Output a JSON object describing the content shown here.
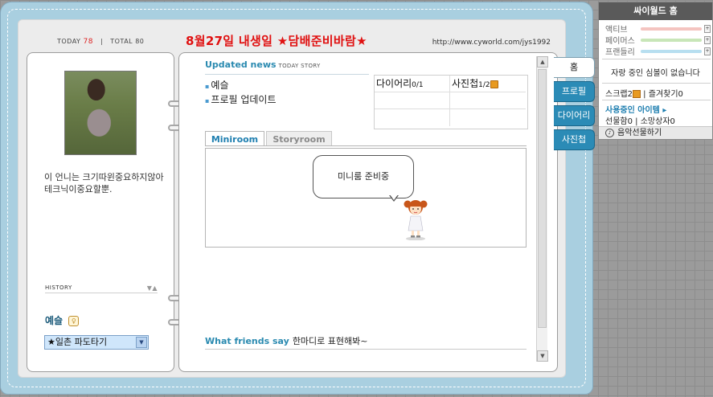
{
  "header": {
    "today_label": "TODAY",
    "today_count": "78",
    "total_label": "TOTAL",
    "total_count": "80",
    "headline": "8월27일 내생일  ★담배준비바람★",
    "url": "http://www.cyworld.com/jys1992"
  },
  "profile": {
    "intro": "이 언니는 크기따윈중요하지않아 테크닉이중요할뿐.",
    "history_label": "HISTORY",
    "history_icon": "▼▲",
    "name": "예슬",
    "name_badge": "♀",
    "select_value": "★일촌 파도타기",
    "select_arrow": "▼"
  },
  "updated": {
    "title": "Updated news",
    "subtitle": "TODAY STORY",
    "items": [
      "예슬",
      "프로필 업데이트"
    ],
    "counts": {
      "diary_label": "다이어리",
      "diary_value": "0/1",
      "photo_label": "사진첩",
      "photo_value": "1/2"
    }
  },
  "tabs": {
    "miniroom": "Miniroom",
    "storyroom": "Storyroom"
  },
  "miniroom": {
    "bubble": "미니룸 준비중"
  },
  "scroll": {
    "up": "▲",
    "down": "▼"
  },
  "friends": {
    "title": "What friends say",
    "subtitle": "한마디로 표현해봐~"
  },
  "side_tabs": [
    "홈",
    "프로필",
    "다이어리",
    "사진첩"
  ],
  "panel": {
    "title": "싸이월드 홈",
    "stats": [
      {
        "label": "액티브",
        "color": "#f4c4c0"
      },
      {
        "label": "페이머스",
        "color": "#c8e6b8"
      },
      {
        "label": "프랜들리",
        "color": "#b8dff0"
      }
    ],
    "stat_handle": "+",
    "boring": "자랑 중인 심볼이 없습니다",
    "scrap": "스크랩2",
    "favorites": "즐겨찾기0",
    "items_link": "사용중인 아이템 ▸",
    "gift": "선물함0",
    "wish": "소망상자0",
    "music": "음악선물하기",
    "music_icon": "♪"
  }
}
